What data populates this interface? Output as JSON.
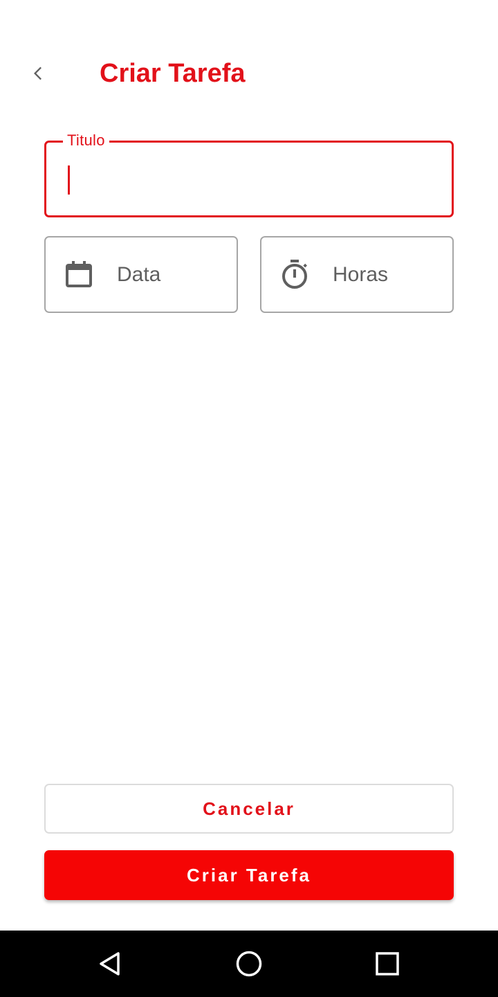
{
  "header": {
    "title": "Criar Tarefa",
    "back_icon": "chevron-left-icon"
  },
  "form": {
    "title_field": {
      "label": "Titulo",
      "value": ""
    },
    "date_picker": {
      "label": "Data",
      "icon": "calendar-icon"
    },
    "time_picker": {
      "label": "Horas",
      "icon": "stopwatch-icon"
    }
  },
  "actions": {
    "cancel_label": "Cancelar",
    "create_label": "Criar Tarefa"
  },
  "system_nav": {
    "back_icon": "triangle-back-icon",
    "home_icon": "circle-home-icon",
    "recents_icon": "square-recents-icon"
  },
  "colors": {
    "accent": "#e2111a",
    "primary_button": "#f50505",
    "border_gray": "#a6a6a6",
    "nav_bar": "#000000"
  }
}
